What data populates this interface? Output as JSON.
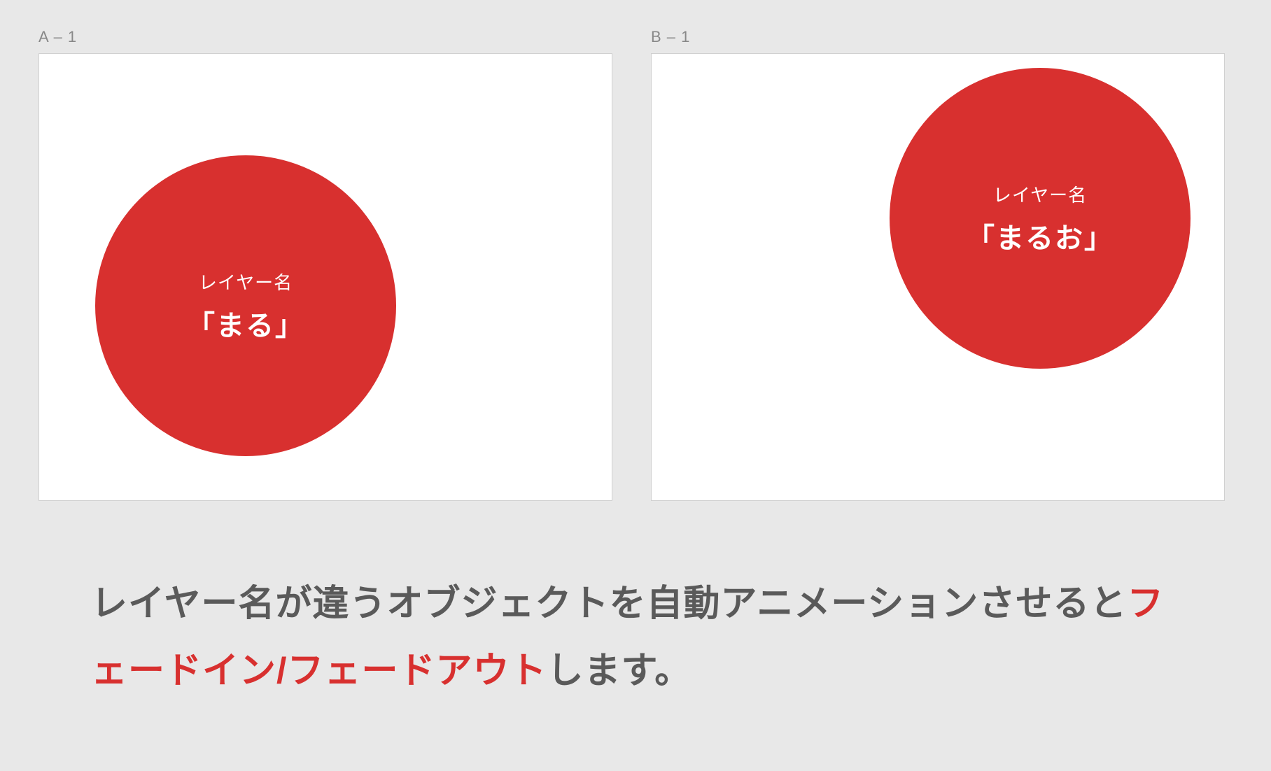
{
  "artboards": {
    "a": {
      "label": "A – 1",
      "circle": {
        "label": "レイヤー名",
        "name": "「まる」"
      }
    },
    "b": {
      "label": "B – 1",
      "circle": {
        "label": "レイヤー名",
        "name": "「まるお」"
      }
    }
  },
  "caption": {
    "part1": "レイヤー名が違うオブジェクトを自動アニメーションさせると",
    "highlight": "フェードイン/フェードアウト",
    "part2": "します。"
  },
  "colors": {
    "circle": "#d8302f",
    "background": "#e8e8e8",
    "artboard": "#ffffff"
  }
}
